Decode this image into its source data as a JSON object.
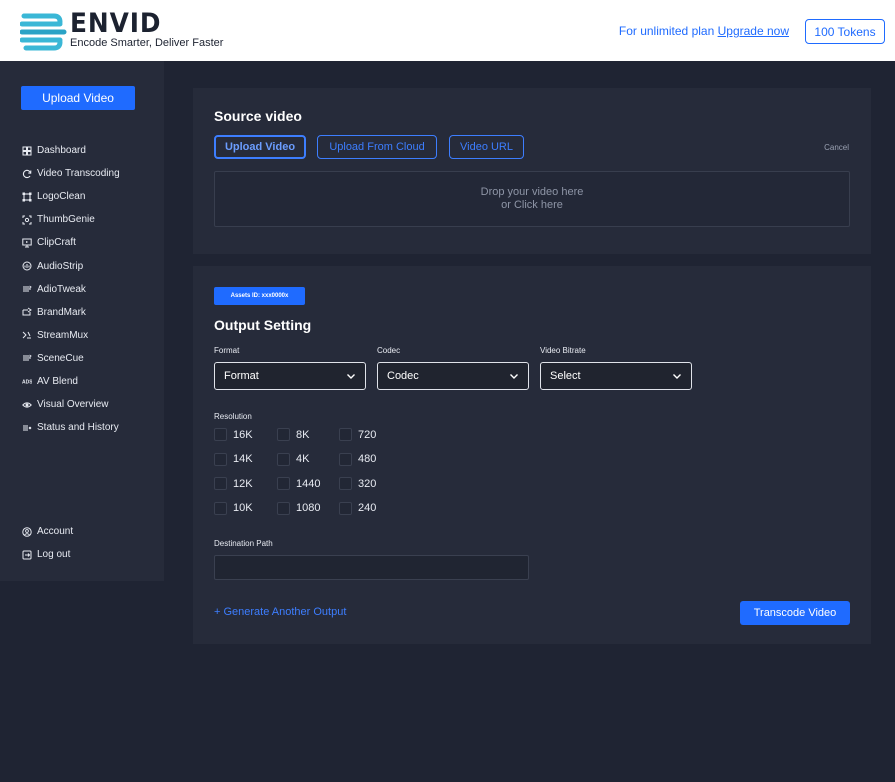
{
  "header": {
    "brand": "ENVID",
    "tagline": "Encode Smarter, Deliver Faster",
    "upgrade_prefix": "For unlimited plan",
    "upgrade_link": "Upgrade now",
    "tokens": "100 Tokens"
  },
  "sidebar": {
    "upload_label": "Upload Video",
    "items": [
      {
        "label": "Dashboard",
        "icon": "grid-icon"
      },
      {
        "label": "Video Transcoding",
        "icon": "refresh-icon"
      },
      {
        "label": "LogoClean",
        "icon": "crop-icon"
      },
      {
        "label": "ThumbGenie",
        "icon": "scan-icon"
      },
      {
        "label": "ClipCraft",
        "icon": "monitor-icon"
      },
      {
        "label": "AudioStrip",
        "icon": "audio-icon"
      },
      {
        "label": "AdioTweak",
        "icon": "lines-icon"
      },
      {
        "label": "BrandMark",
        "icon": "brand-icon"
      },
      {
        "label": "StreamMux",
        "icon": "mux-icon"
      },
      {
        "label": "SceneCue",
        "icon": "lines-icon"
      },
      {
        "label": "AV Blend",
        "icon": "av-icon"
      },
      {
        "label": "Visual Overview",
        "icon": "eye-icon"
      },
      {
        "label": "Status and History",
        "icon": "list-check-icon"
      }
    ],
    "bottom_items": [
      {
        "label": "Account",
        "icon": "user-icon"
      },
      {
        "label": "Log out",
        "icon": "logout-icon"
      }
    ]
  },
  "source": {
    "title": "Source video",
    "tabs": [
      "Upload Video",
      "Upload From Cloud",
      "Video URL"
    ],
    "cancel": "Cancel",
    "drop_line1": "Drop your video here",
    "drop_line2": "or Click here"
  },
  "output": {
    "asset_id": "Assets ID: xxx0000x",
    "title": "Output Setting",
    "format_label": "Format",
    "format_value": "Format",
    "codec_label": "Codec",
    "codec_value": "Codec",
    "bitrate_label": "Video Bitrate",
    "bitrate_value": "Select",
    "resolution_label": "Resolution",
    "resolutions": [
      [
        "16K",
        "8K",
        "720"
      ],
      [
        "14K",
        "4K",
        "480"
      ],
      [
        "12K",
        "1440",
        "320"
      ],
      [
        "10K",
        "1080",
        "240"
      ]
    ],
    "destination_label": "Destination Path",
    "destination_value": "",
    "generate_link": "+ Generate Another Output",
    "transcode_button": "Transcode Video"
  },
  "colors": {
    "accent": "#1f6bff",
    "background": "#1f2433",
    "panel": "#262b3a"
  }
}
